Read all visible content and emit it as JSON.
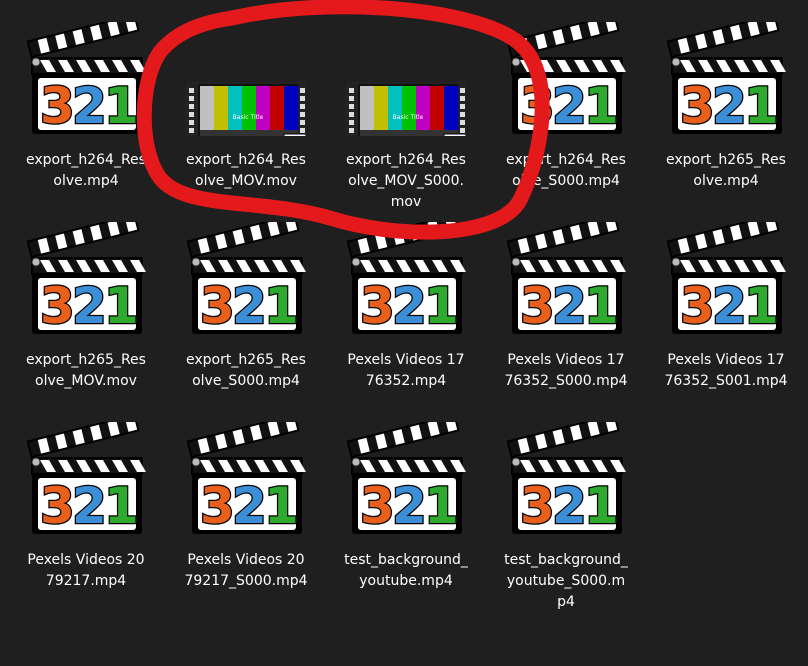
{
  "files": [
    {
      "name": "export_h264_Resolve.mp4",
      "icon": "mpc-hc-clapperboard-icon"
    },
    {
      "name": "export_h264_Resolve_MOV.mov",
      "icon": "video-thumbnail-color-bars"
    },
    {
      "name": "export_h264_Resolve_MOV_S000.mov",
      "icon": "video-thumbnail-color-bars"
    },
    {
      "name": "export_h264_Resolve_S000.mp4",
      "icon": "mpc-hc-clapperboard-icon"
    },
    {
      "name": "export_h265_Resolve.mp4",
      "icon": "mpc-hc-clapperboard-icon"
    },
    {
      "name": "export_h265_Resolve_MOV.mov",
      "icon": "mpc-hc-clapperboard-icon"
    },
    {
      "name": "export_h265_Resolve_S000.mp4",
      "icon": "mpc-hc-clapperboard-icon"
    },
    {
      "name": "Pexels Videos 1776352.mp4",
      "icon": "mpc-hc-clapperboard-icon"
    },
    {
      "name": "Pexels Videos 1776352_S000.mp4",
      "icon": "mpc-hc-clapperboard-icon"
    },
    {
      "name": "Pexels Videos 1776352_S001.mp4",
      "icon": "mpc-hc-clapperboard-icon"
    },
    {
      "name": "Pexels Videos 2079217.mp4",
      "icon": "mpc-hc-clapperboard-icon"
    },
    {
      "name": "Pexels Videos 2079217_S000.mp4",
      "icon": "mpc-hc-clapperboard-icon"
    },
    {
      "name": "test_background_youtube.mp4",
      "icon": "mpc-hc-clapperboard-icon"
    },
    {
      "name": "test_background_youtube_S000.mp4",
      "icon": "mpc-hc-clapperboard-icon"
    }
  ],
  "thumbnail_caption": "Basic Title",
  "icon_badge": "321",
  "icon_digits": [
    "3",
    "2",
    "1"
  ],
  "colors": {
    "background": "#1f1f1f",
    "text": "#ffffff",
    "annotation": "#e3191b",
    "digit_3": "#e8601c",
    "digit_2": "#3b8fd9",
    "digit_1": "#2eaa2e"
  }
}
